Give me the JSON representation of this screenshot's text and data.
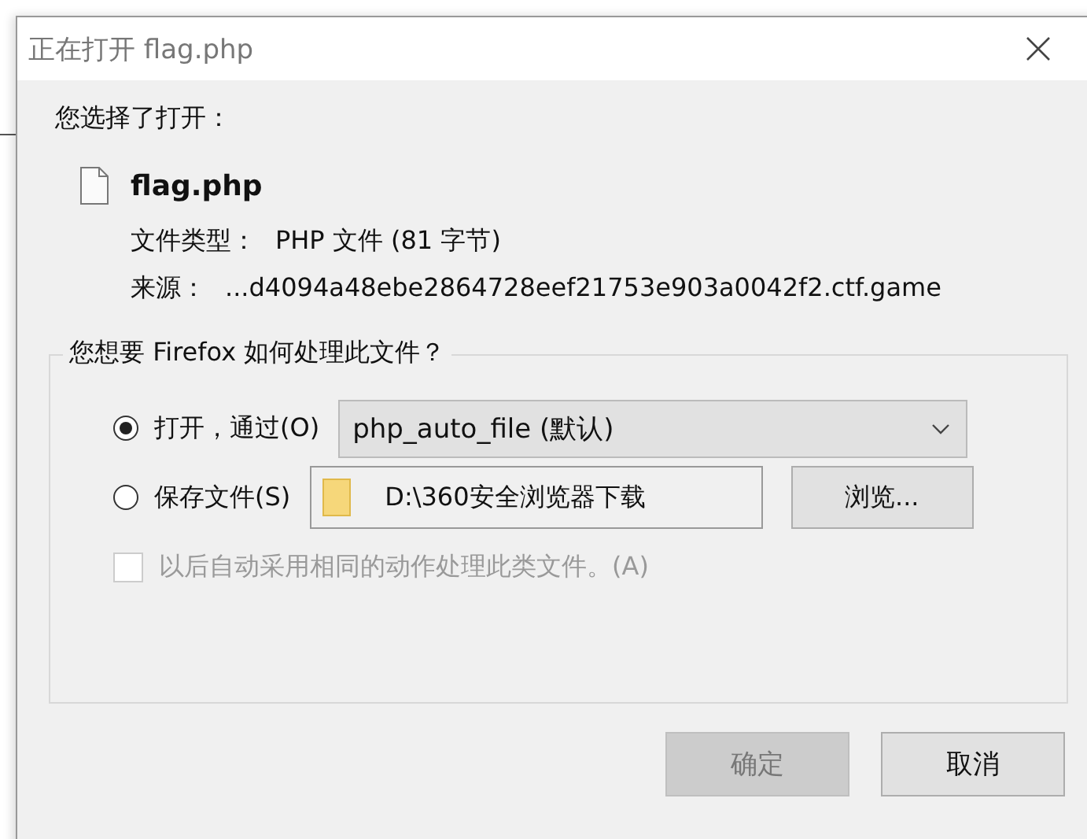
{
  "window": {
    "title": "正在打开 flag.php"
  },
  "intro": "您选择了打开：",
  "file": {
    "name": "flag.php",
    "type_label": "文件类型：",
    "type_value": "PHP 文件 (81 字节)",
    "source_label": "来源：",
    "source_value": "...d4094a48ebe2864728eef21753e903a0042f2.ctf.game"
  },
  "group": {
    "legend": "您想要 Firefox 如何处理此文件？",
    "options": [
      {
        "kind": "open",
        "label": "打开，通过(O)",
        "selected": true,
        "value": "php_auto_file (默认)"
      },
      {
        "kind": "save",
        "label": "保存文件(S)",
        "selected": false,
        "value": "D:\\360安全浏览器下载",
        "button": "浏览..."
      }
    ],
    "remember": {
      "label": "以后自动采用相同的动作处理此类文件。(A)",
      "checked": false,
      "disabled": true
    }
  },
  "buttons": [
    {
      "label": "确定",
      "disabled": true
    },
    {
      "label": "取消",
      "disabled": false
    }
  ]
}
